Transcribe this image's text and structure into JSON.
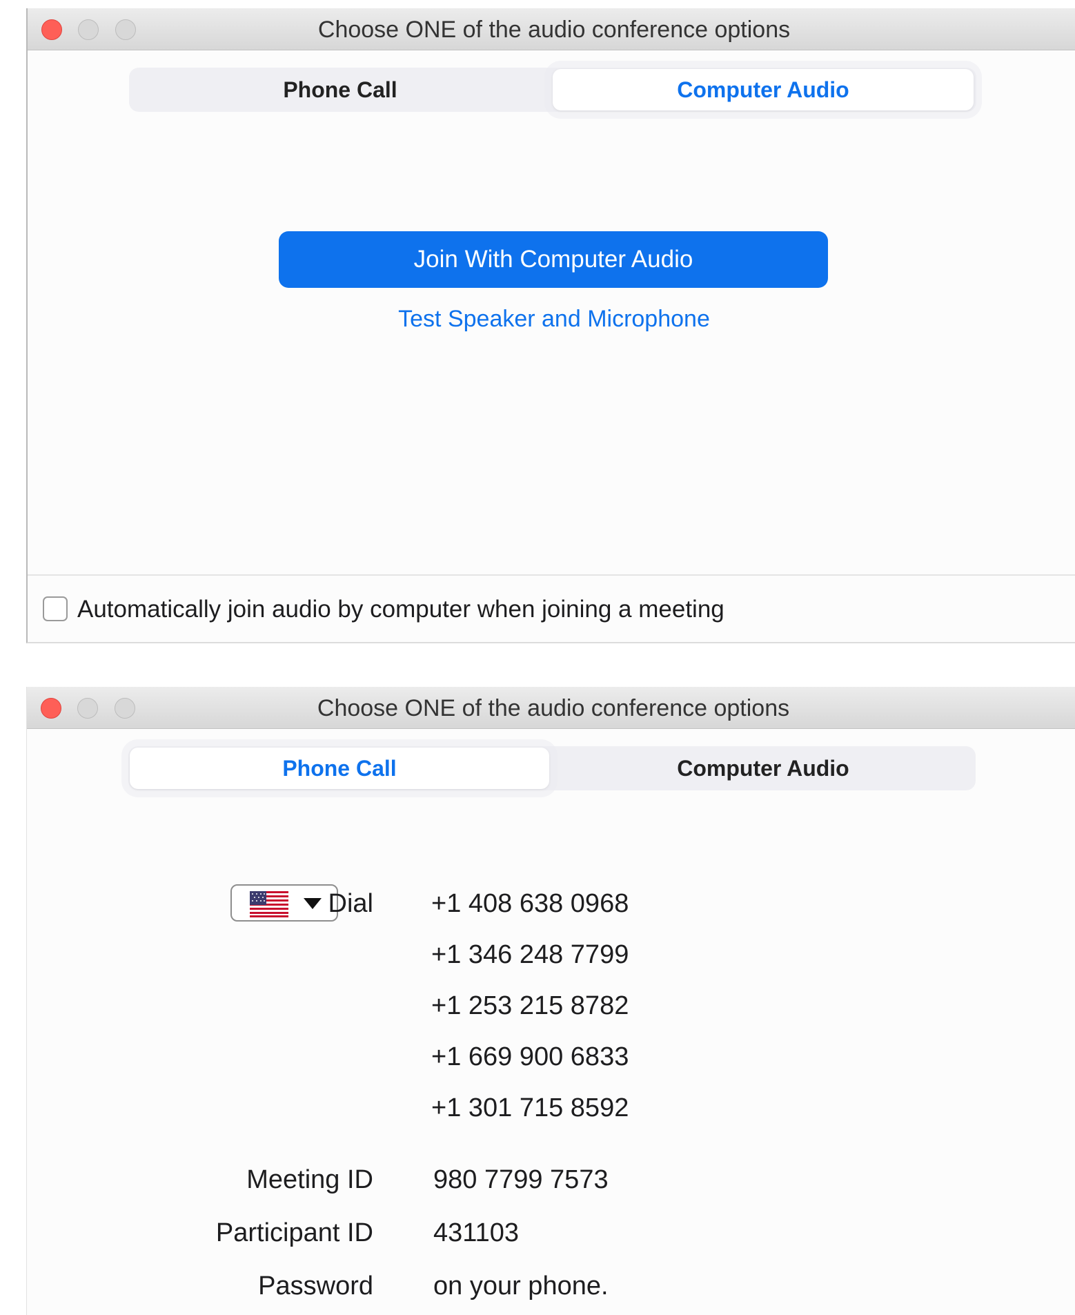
{
  "window1": {
    "title": "Choose ONE of the audio conference options",
    "tabs": [
      {
        "label": "Phone Call",
        "active": false
      },
      {
        "label": "Computer Audio",
        "active": true
      }
    ],
    "join_button_label": "Join With Computer Audio",
    "test_link_label": "Test Speaker and Microphone",
    "auto_join_checkbox": {
      "label": "Automatically join audio by computer when joining a meeting",
      "checked": false
    }
  },
  "window2": {
    "title": "Choose ONE of the audio conference options",
    "tabs": [
      {
        "label": "Phone Call",
        "active": true
      },
      {
        "label": "Computer Audio",
        "active": false
      }
    ],
    "country_selector": {
      "flag_icon": "us-flag-icon"
    },
    "dial_label": "Dial",
    "dial_numbers": [
      "+1 408 638 0968",
      "+1 346 248 7799",
      "+1 253 215 8782",
      "+1 669 900 6833",
      "+1 301 715 8592"
    ],
    "meeting_id_label": "Meeting ID",
    "meeting_id": "980 7799 7573",
    "participant_id_label": "Participant ID",
    "participant_id": "431103",
    "password_label": "Password",
    "password_value": "on your phone."
  },
  "colors": {
    "accent_blue": "#0e72ed",
    "close_red": "#fe5f57",
    "segment_bg": "#efeff3"
  },
  "icons": {
    "close": "close-icon",
    "minimize": "minimize-icon",
    "maximize": "maximize-icon",
    "dropdown": "caret-down-icon"
  }
}
